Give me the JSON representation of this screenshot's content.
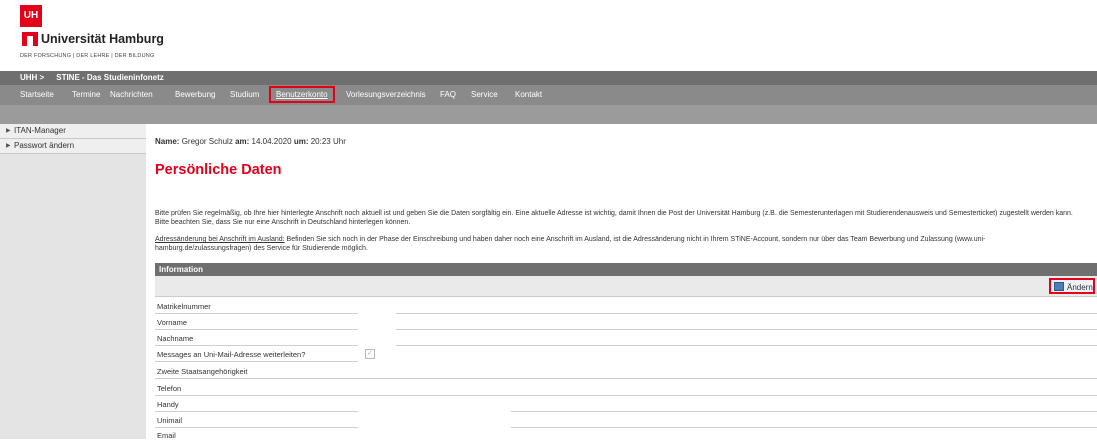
{
  "logo": {
    "mark": "UH",
    "name": "Universität Hamburg",
    "tagline": "DER FORSCHUNG | DER LEHRE | DER BILDUNG"
  },
  "breadcrumb": {
    "root": "UHH >",
    "current": "STINE - Das Studieninfonetz"
  },
  "nav": {
    "items": [
      "Startseite",
      "Termine",
      "Nachrichten",
      "Bewerbung",
      "Studium",
      "Benutzerkonto",
      "Vorlesungsverzeichnis",
      "FAQ",
      "Service",
      "Kontakt"
    ],
    "active": "Benutzerkonto"
  },
  "sidebar": {
    "items": [
      {
        "label": "ITAN-Manager"
      },
      {
        "label": "Passwort ändern"
      }
    ]
  },
  "user": {
    "name_label": "Name:",
    "name": "Gregor Schulz",
    "am_label": "am:",
    "date": "14.04.2020",
    "um_label": "um:",
    "time": "20:23 Uhr"
  },
  "page_title": "Persönliche Daten",
  "intro": {
    "p1": "Bitte prüfen Sie regelmäßig, ob Ihre hier hinterlegte Anschrift noch aktuell ist und geben Sie die Daten sorgfältig ein. Eine aktuelle Adresse ist wichtig, damit Ihnen die Post der Universität Hamburg (z.B. die Semesterunterlagen mit Studierendenausweis und Semesterticket) zugestellt werden kann. Bitte beachten Sie, dass Sie nur eine Anschrift in Deutschland hinterlegen können.",
    "p2_label": "Adressänderung bei Anschrift im Ausland:",
    "p2": " Befinden Sie sich noch in der Phase der Einschreibung und haben daher noch eine Anschrift im Ausland, ist die Adressänderung nicht in Ihrem STiNE-Account, sondern nur über das Team Bewerbung und Zulassung (www.uni-hamburg.de/zulassungsfragen) des Service für Studierende möglich."
  },
  "info": {
    "header": "Information",
    "edit_label": "Ändern",
    "fields": [
      {
        "label": "Matrikelnummer"
      },
      {
        "label": "Vorname"
      },
      {
        "label": "Nachname"
      },
      {
        "label": "Messages an Uni-Mail-Adresse weiterleiten?",
        "checkbox": "✓"
      },
      {
        "label": "Zweite Staatsangehörigkeit"
      },
      {
        "label": "Telefon"
      },
      {
        "label": "Handy"
      },
      {
        "label": "Unimail"
      },
      {
        "label": "Email"
      }
    ]
  }
}
